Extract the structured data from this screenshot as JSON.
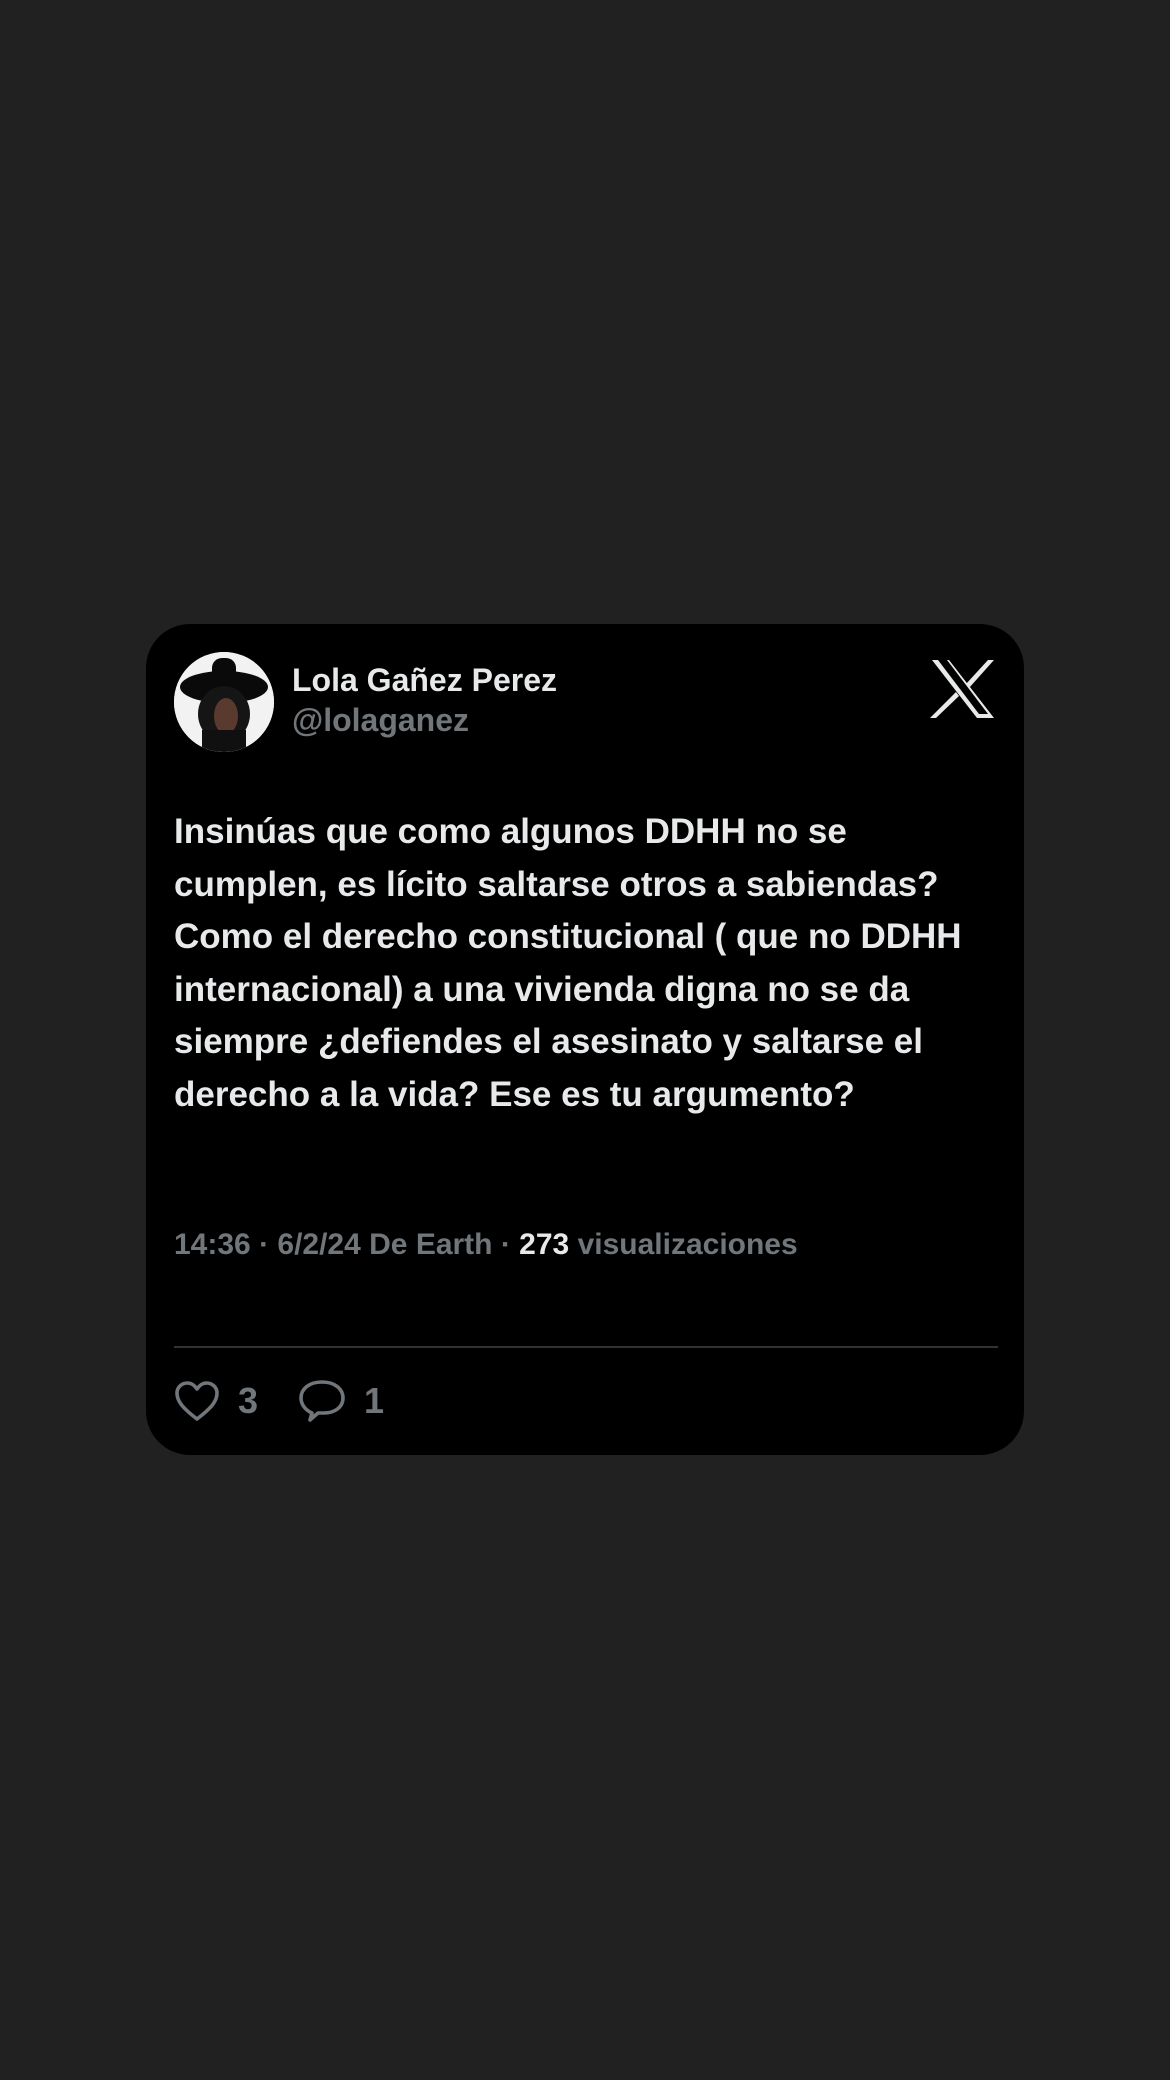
{
  "tweet": {
    "author_name": "Lola Gañez Perez",
    "author_handle": "@lolaganez",
    "text": "Insinúas que como algunos DDHH no se cumplen, es lícito saltarse otros a sabiendas? Como el derecho constitucional ( que no DDHH internacional) a una vivienda digna no se da siempre ¿defiendes el asesinato y saltarse el derecho a la vida? Ese es tu argumento?",
    "meta_prefix": "14:36 · 6/2/24 De Earth · ",
    "views_count": "273",
    "views_label": " visualizaciones",
    "likes_count": "3",
    "replies_count": "1"
  },
  "icons": {
    "logo": "x-logo-icon",
    "like": "heart-icon",
    "reply": "comment-icon"
  },
  "colors": {
    "page_background": "#212121",
    "card_background": "#000000",
    "primary_text": "#e7e9ea",
    "secondary_text": "#71767b",
    "divider": "#2f3336"
  }
}
